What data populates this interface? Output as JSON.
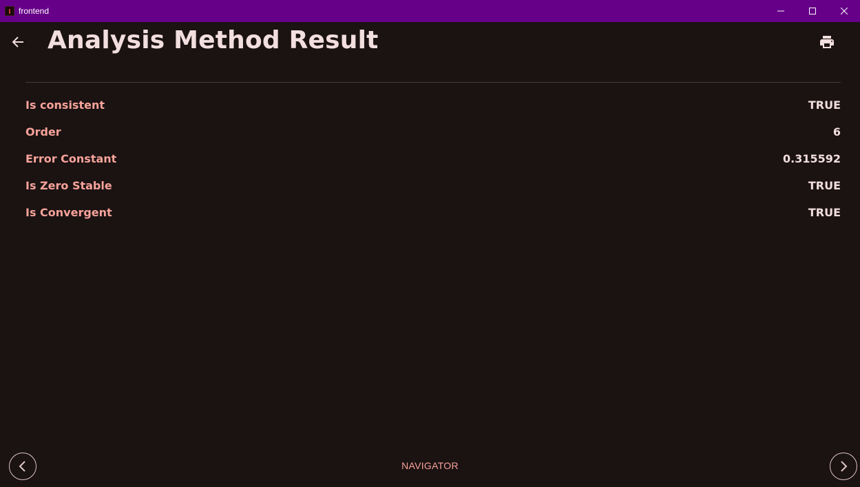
{
  "window": {
    "title": "frontend"
  },
  "header": {
    "title": "Analysis Method Result"
  },
  "results": [
    {
      "label": "Is consistent",
      "value": "TRUE"
    },
    {
      "label": "Order",
      "value": "6"
    },
    {
      "label": "Error Constant",
      "value": "0.315592"
    },
    {
      "label": "Is Zero Stable",
      "value": "TRUE"
    },
    {
      "label": "Is Convergent",
      "value": "TRUE"
    }
  ],
  "footer": {
    "navigator_label": "NAVIGATOR"
  },
  "icons": {
    "back": "arrow-left-icon",
    "print": "printer-icon",
    "prev": "chevron-left-icon",
    "next": "chevron-right-icon"
  },
  "colors": {
    "titlebar": "#660088",
    "background": "#1b1212",
    "label": "#f7a39a",
    "value": "#f2dede"
  }
}
